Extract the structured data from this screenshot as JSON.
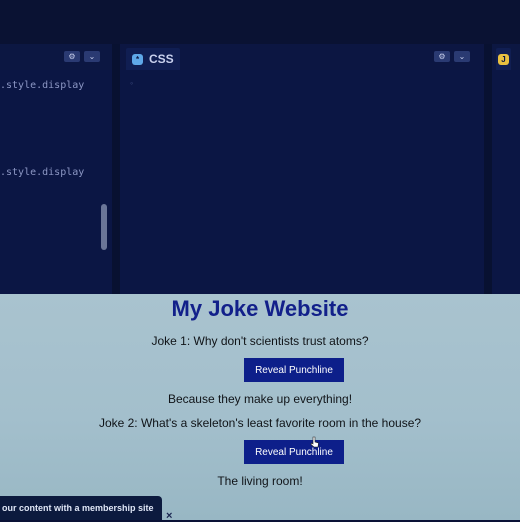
{
  "editor": {
    "js_pane": {
      "code_lines": [
        ".style.display",
        ".style.display"
      ]
    },
    "css_pane": {
      "tab_label": "CSS",
      "badge": "*"
    },
    "html_pane": {
      "badge": "J"
    },
    "controls": {
      "settings_icon": "gear-icon",
      "collapse_icon": "chevron-down-icon"
    }
  },
  "preview": {
    "title": "My Joke Website",
    "jokes": [
      {
        "question": "Joke 1: Why don't scientists trust atoms?",
        "button_label": "Reveal Punchline",
        "punchline": "Because they make up everything!"
      },
      {
        "question": "Joke 2: What's a skeleton's least favorite room in the house?",
        "button_label": "Reveal Punchline",
        "punchline": "The living room!"
      }
    ]
  },
  "toast": {
    "text": "our content with a membership site",
    "close": "×"
  },
  "colors": {
    "editor_bg": "#0b1644",
    "preview_bg": "#a9c3cf",
    "title": "#12208a",
    "button": "#0d1f8a"
  }
}
